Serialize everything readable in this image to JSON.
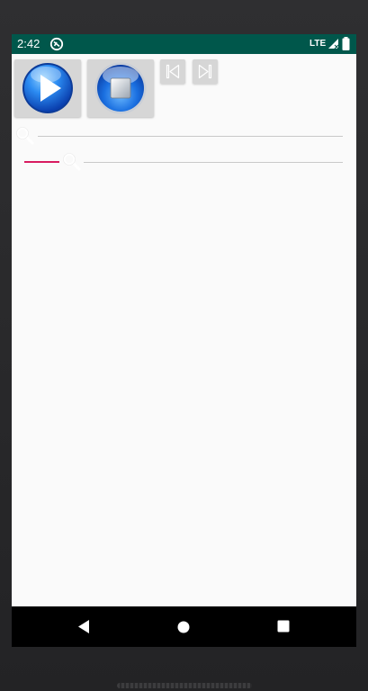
{
  "status_bar": {
    "time": "2:42",
    "network": "LTE",
    "background_color": "#00574b",
    "icons": [
      "app-notification-icon",
      "signal-icon",
      "battery-icon"
    ]
  },
  "player": {
    "buttons": [
      {
        "name": "play",
        "icon": "play-icon"
      },
      {
        "name": "stop",
        "icon": "stop-icon"
      },
      {
        "name": "previous",
        "icon": "skip-previous-icon"
      },
      {
        "name": "next",
        "icon": "skip-next-icon"
      }
    ],
    "seek_bars": [
      {
        "name": "seek-bar-1",
        "progress": 0
      },
      {
        "name": "seek-bar-2",
        "progress": 0.11
      }
    ],
    "accent_color": "#d81b60"
  },
  "navigation_bar": {
    "icons": [
      "back-icon",
      "home-icon",
      "recents-icon"
    ]
  }
}
